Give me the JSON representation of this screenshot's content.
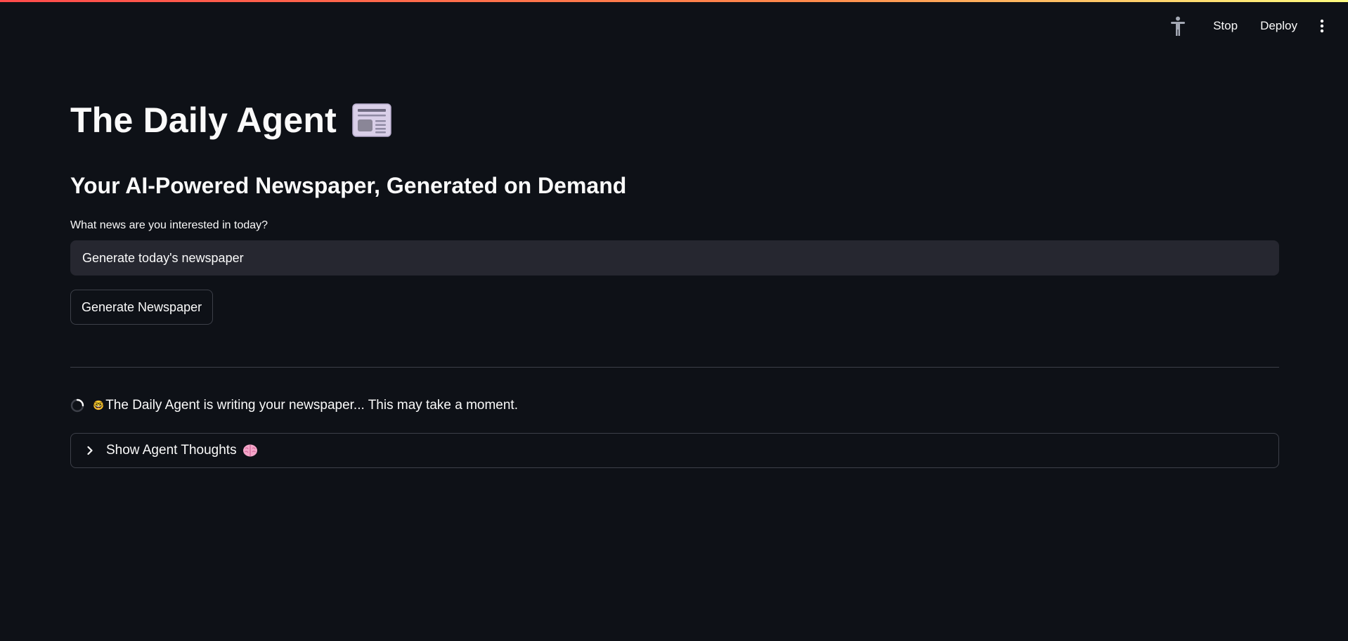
{
  "app": {
    "accent_gradient": [
      "#ff4b4b",
      "#ff8a4b",
      "#fffd80"
    ],
    "background": "#0e1117"
  },
  "toolbar": {
    "accessibility_icon": "person-standing-icon",
    "stop_label": "Stop",
    "deploy_label": "Deploy",
    "menu_icon": "vertical-ellipsis-icon"
  },
  "main": {
    "title": "The Daily Agent",
    "title_icon": "newspaper-icon",
    "subtitle": "Your AI-Powered Newspaper, Generated on Demand",
    "input_label": "What news are you interested in today?",
    "input_value": "Generate today's newspaper",
    "generate_button_label": "Generate Newspaper",
    "status_text": "The Daily Agent is writing your newspaper... This may take a moment.",
    "status_emoji": "🤓",
    "expander_label": "Show Agent Thoughts",
    "expander_icon": "brain-icon"
  }
}
